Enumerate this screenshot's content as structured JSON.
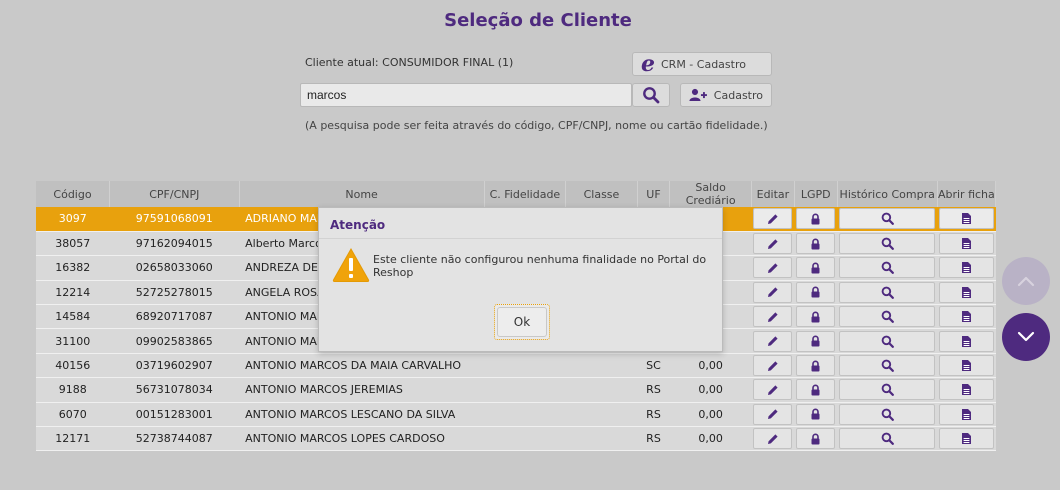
{
  "page": {
    "title": "Seleção de Cliente"
  },
  "client": {
    "current_label": "Cliente atual: CONSUMIDOR FINAL (1)"
  },
  "buttons": {
    "crm_label": "CRM - Cadastro",
    "cadastro_label": "Cadastro"
  },
  "search": {
    "value": "marcos",
    "hint": "(A pesquisa pode ser feita através do código, CPF/CNPJ, nome ou cartão fidelidade.)"
  },
  "table": {
    "headers": {
      "codigo": "Código",
      "cpf": "CPF/CNPJ",
      "nome": "Nome",
      "fidelidade": "C. Fidelidade",
      "classe": "Classe",
      "uf": "UF",
      "saldo": "Saldo Crediário",
      "editar": "Editar",
      "lgpd": "LGPD",
      "historico": "Histórico Compra",
      "ficha": "Abrir ficha"
    },
    "rows": [
      {
        "codigo": "3097",
        "cpf": "97591068091",
        "nome": "ADRIANO MARCOS",
        "uf": "",
        "saldo": ""
      },
      {
        "codigo": "38057",
        "cpf": "97162094015",
        "nome": "Alberto Marcos M",
        "uf": "",
        "saldo": ""
      },
      {
        "codigo": "16382",
        "cpf": "02658033060",
        "nome": "ANDREZA DE SOU",
        "uf": "",
        "saldo": ""
      },
      {
        "codigo": "12214",
        "cpf": "52725278015",
        "nome": "ANGELA ROSA BA",
        "uf": "",
        "saldo": ""
      },
      {
        "codigo": "14584",
        "cpf": "68920717087",
        "nome": "ANTONIO MARCO",
        "uf": "",
        "saldo": ""
      },
      {
        "codigo": "31100",
        "cpf": "09902583865",
        "nome": "ANTONIO MARCO",
        "uf": "",
        "saldo": ""
      },
      {
        "codigo": "40156",
        "cpf": "03719602907",
        "nome": "ANTONIO MARCOS DA MAIA CARVALHO",
        "uf": "SC",
        "saldo": "0,00"
      },
      {
        "codigo": "9188",
        "cpf": "56731078034",
        "nome": "ANTONIO MARCOS JEREMIAS",
        "uf": "RS",
        "saldo": "0,00"
      },
      {
        "codigo": "6070",
        "cpf": "00151283001",
        "nome": "ANTONIO MARCOS LESCANO DA SILVA",
        "uf": "RS",
        "saldo": "0,00"
      },
      {
        "codigo": "12171",
        "cpf": "52738744087",
        "nome": "ANTONIO MARCOS LOPES CARDOSO",
        "uf": "RS",
        "saldo": "0,00"
      }
    ]
  },
  "dialog": {
    "title": "Atenção",
    "message": "Este cliente não configurou nenhuma finalidade no Portal do Reshop",
    "ok_label": "Ok"
  },
  "colors": {
    "accent": "#4e2a7f",
    "selected_row": "#e8a10d",
    "warning": "#f0a30a"
  },
  "icons": [
    "ie-icon",
    "search-icon",
    "add-user-icon",
    "pencil-icon",
    "lock-icon",
    "document-icon",
    "warning-icon",
    "chevron-up-icon",
    "chevron-down-icon"
  ]
}
